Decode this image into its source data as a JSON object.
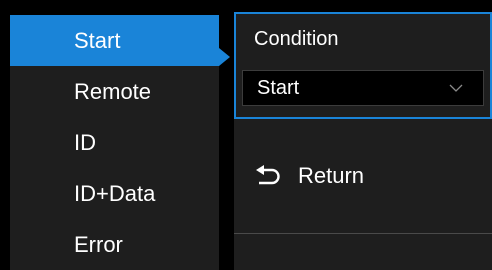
{
  "options_list": {
    "items": [
      {
        "label": "Start",
        "selected": true
      },
      {
        "label": "Remote",
        "selected": false
      },
      {
        "label": "ID",
        "selected": false
      },
      {
        "label": "ID+Data",
        "selected": false
      },
      {
        "label": "Error",
        "selected": false
      }
    ]
  },
  "menu": {
    "condition_label": "Condition",
    "condition_value": "Start",
    "return_label": "Return"
  },
  "colors": {
    "accent": "#1a84d8",
    "panel_bg": "#1e1e1e",
    "background": "#000000"
  },
  "icons": {
    "chevron": "chevron-down-icon",
    "return": "return-arrow-icon"
  }
}
